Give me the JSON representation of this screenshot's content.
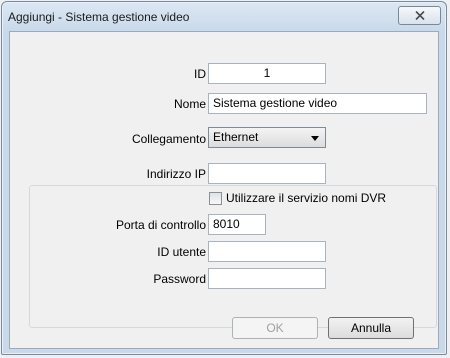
{
  "window": {
    "title": "Aggiungi - Sistema gestione video"
  },
  "form": {
    "id_label": "ID",
    "id_value": "1",
    "name_label": "Nome",
    "name_value": "Sistema gestione video",
    "connection_label": "Collegamento",
    "connection_value": "Ethernet",
    "ip_label": "Indirizzo IP",
    "ip_value": "",
    "dvr_checkbox_label": "Utilizzare il servizio nomi DVR",
    "dvr_checkbox_checked": false,
    "control_port_label": "Porta di controllo",
    "control_port_value": "8010",
    "user_id_label": "ID utente",
    "user_id_value": "",
    "password_label": "Password",
    "password_value": ""
  },
  "buttons": {
    "ok_label": "OK",
    "cancel_label": "Annulla"
  },
  "icons": {
    "close": "close-icon",
    "dropdown": "chevron-down-icon"
  },
  "colors": {
    "titlebar": "#c9d9ea",
    "client_background": "#f0f0f0"
  }
}
